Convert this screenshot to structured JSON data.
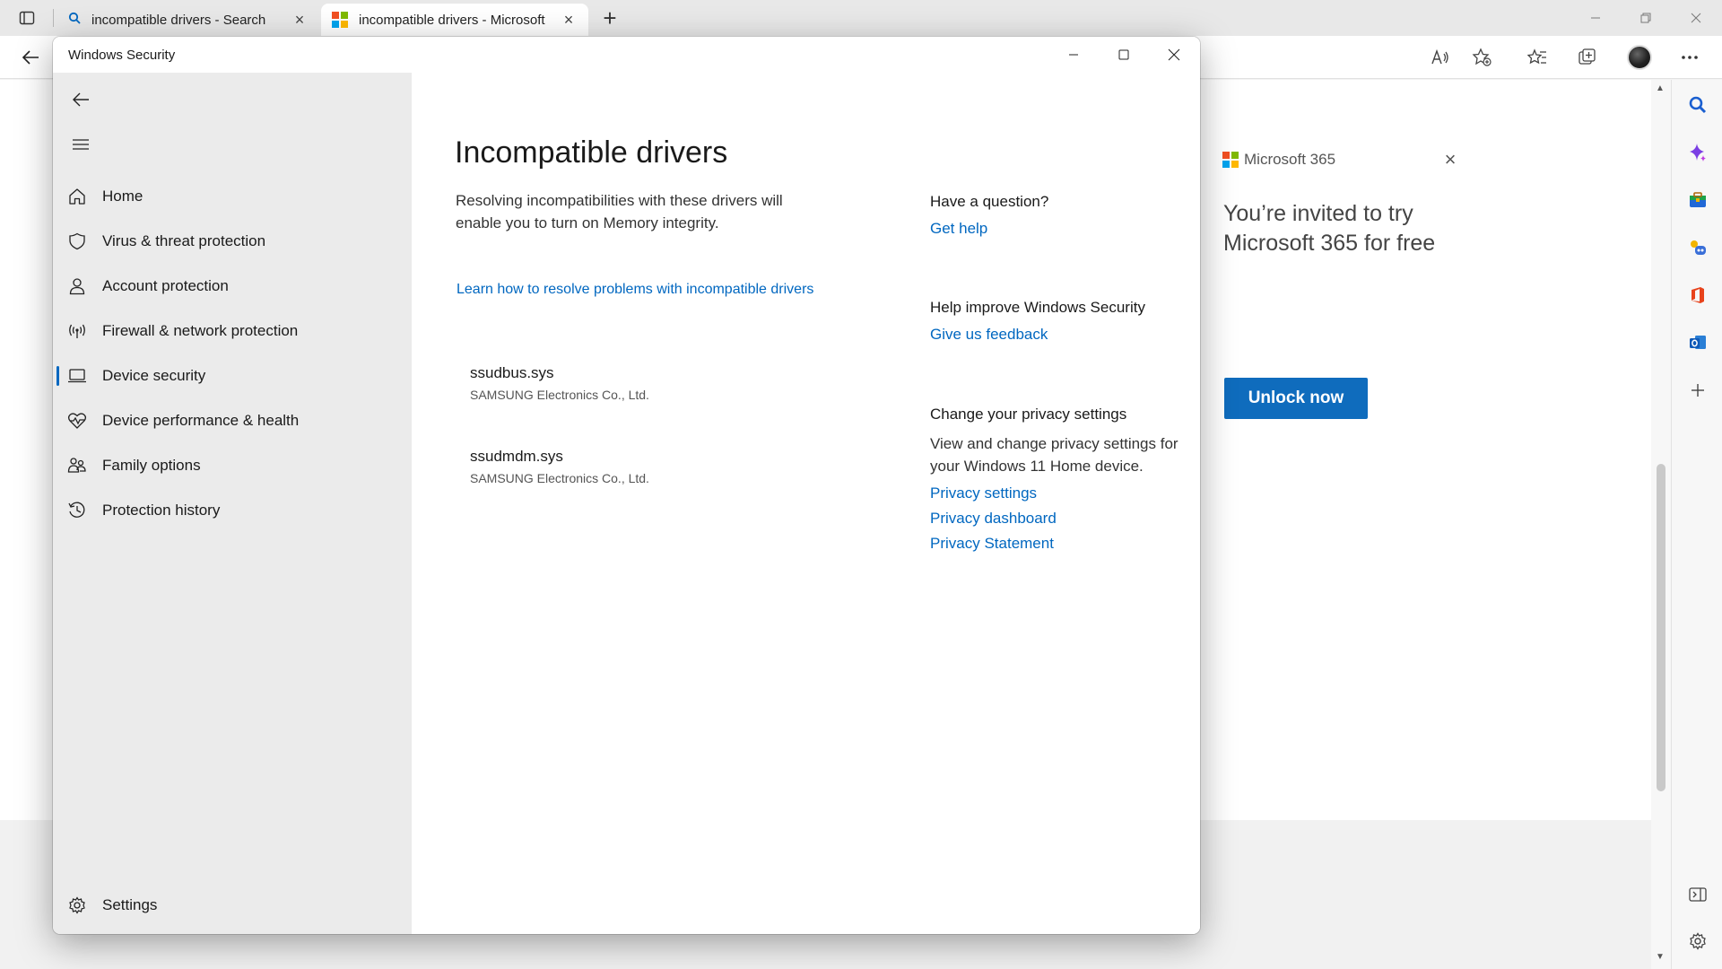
{
  "browser": {
    "tabs": [
      {
        "title": "incompatible drivers - Search",
        "icon": "search-icon"
      },
      {
        "title": "incompatible drivers - Microsoft",
        "icon": "microsoft-logo-icon",
        "active": true
      }
    ],
    "new_tab": "+"
  },
  "ad": {
    "brand": "Microsoft 365",
    "headline": "You’re invited to try Microsoft 365 for free",
    "button": "Unlock now",
    "button_color": "#0f6cbd"
  },
  "window": {
    "title": "Windows Security"
  },
  "nav": {
    "items": [
      {
        "label": "Home",
        "icon": "home-icon"
      },
      {
        "label": "Virus & threat protection",
        "icon": "shield-icon"
      },
      {
        "label": "Account protection",
        "icon": "person-icon"
      },
      {
        "label": "Firewall & network protection",
        "icon": "antenna-icon"
      },
      {
        "label": "Device security",
        "icon": "laptop-icon",
        "selected": true
      },
      {
        "label": "Device performance & health",
        "icon": "heart-pulse-icon"
      },
      {
        "label": "Family options",
        "icon": "family-icon"
      },
      {
        "label": "Protection history",
        "icon": "history-icon"
      }
    ],
    "settings": "Settings"
  },
  "main": {
    "title": "Incompatible drivers",
    "description": "Resolving incompatibilities with these drivers will enable you to turn on Memory integrity.",
    "learn_link": "Learn how to resolve problems with incompatible drivers",
    "drivers": [
      {
        "name": "ssudbus.sys",
        "vendor": "SAMSUNG Electronics Co., Ltd."
      },
      {
        "name": "ssudmdm.sys",
        "vendor": "SAMSUNG Electronics Co., Ltd."
      }
    ]
  },
  "aside": {
    "question_heading": "Have a question?",
    "get_help": "Get help",
    "improve_heading": "Help improve Windows Security",
    "feedback": "Give us feedback",
    "privacy_heading": "Change your privacy settings",
    "privacy_text": "View and change privacy settings for your Windows 11 Home device.",
    "privacy_settings": "Privacy settings",
    "privacy_dashboard": "Privacy dashboard",
    "privacy_statement": "Privacy Statement"
  },
  "colors": {
    "accent": "#0067c0",
    "nav_bg": "#ebebeb"
  }
}
